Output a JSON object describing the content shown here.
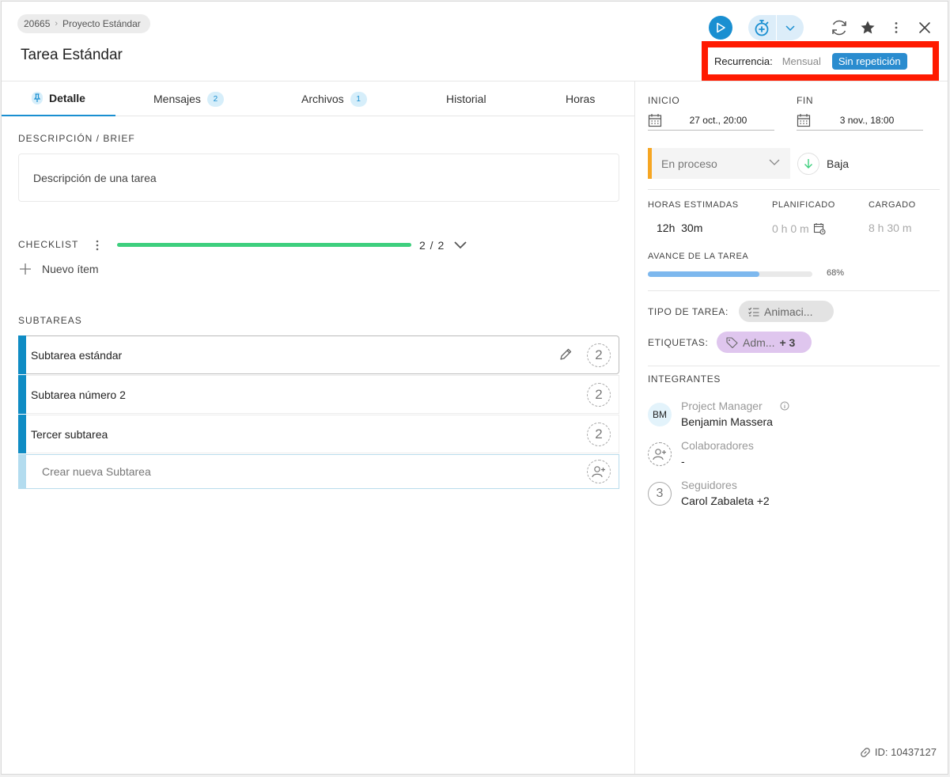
{
  "breadcrumb": {
    "project_id": "20665",
    "project_name": "Proyecto Estándar"
  },
  "title": "Tarea Estándar",
  "recurrence": {
    "label": "Recurrencia:",
    "option_monthly": "Mensual",
    "option_active": "Sin repetición"
  },
  "tabs": [
    {
      "label": "Detalle",
      "badge": ""
    },
    {
      "label": "Mensajes",
      "badge": "2"
    },
    {
      "label": "Archivos",
      "badge": "1"
    },
    {
      "label": "Historial",
      "badge": ""
    },
    {
      "label": "Horas",
      "badge": ""
    }
  ],
  "description": {
    "label": "DESCRIPCIÓN / BRIEF",
    "text": "Descripción de una tarea"
  },
  "checklist": {
    "label": "CHECKLIST",
    "count": "2 / 2",
    "progress": 1.0,
    "new_item": "Nuevo ítem"
  },
  "subtasks": {
    "label": "SUBTAREAS",
    "items": [
      {
        "name": "Subtarea estándar",
        "count": "2"
      },
      {
        "name": "Subtarea número 2",
        "count": "2"
      },
      {
        "name": "Tercer subtarea",
        "count": "2"
      }
    ],
    "new_placeholder": "Crear nueva Subtarea"
  },
  "dates": {
    "start_label": "INICIO",
    "start_value": "27 oct., 20:00",
    "end_label": "FIN",
    "end_value": "3 nov., 18:00"
  },
  "status": {
    "value": "En proceso",
    "color": "#f6a623"
  },
  "priority": {
    "value": "Baja",
    "color": "#3ecf7e"
  },
  "hours": {
    "estimated_label": "HORAS ESTIMADAS",
    "estimated_h": "12h",
    "estimated_m": "30m",
    "planned_label": "PLANIFICADO",
    "planned_value": "0 h 0 m",
    "loaded_label": "CARGADO",
    "loaded_value": "8 h 30 m"
  },
  "progress": {
    "label": "AVANCE DE LA TAREA",
    "value": 0.68,
    "text": "68%"
  },
  "task_type": {
    "label": "TIPO DE TAREA:",
    "value": "Animaci..."
  },
  "tags": {
    "label": "ETIQUETAS:",
    "value": "Adm...",
    "more": "+ 3"
  },
  "members": {
    "label": "INTEGRANTES",
    "pm_role": "Project Manager",
    "pm_initials": "BM",
    "pm_name": "Benjamin Massera",
    "collab_role": "Colaboradores",
    "collab_name": "-",
    "followers_role": "Seguidores",
    "followers_count": "3",
    "followers_name": "Carol Zabaleta +2"
  },
  "footer": {
    "id_text": "ID: 10437127"
  },
  "colors": {
    "accent": "#1a8fd1",
    "highlight": "#ff1a00",
    "subtask_bar": "#0f8cc4"
  }
}
